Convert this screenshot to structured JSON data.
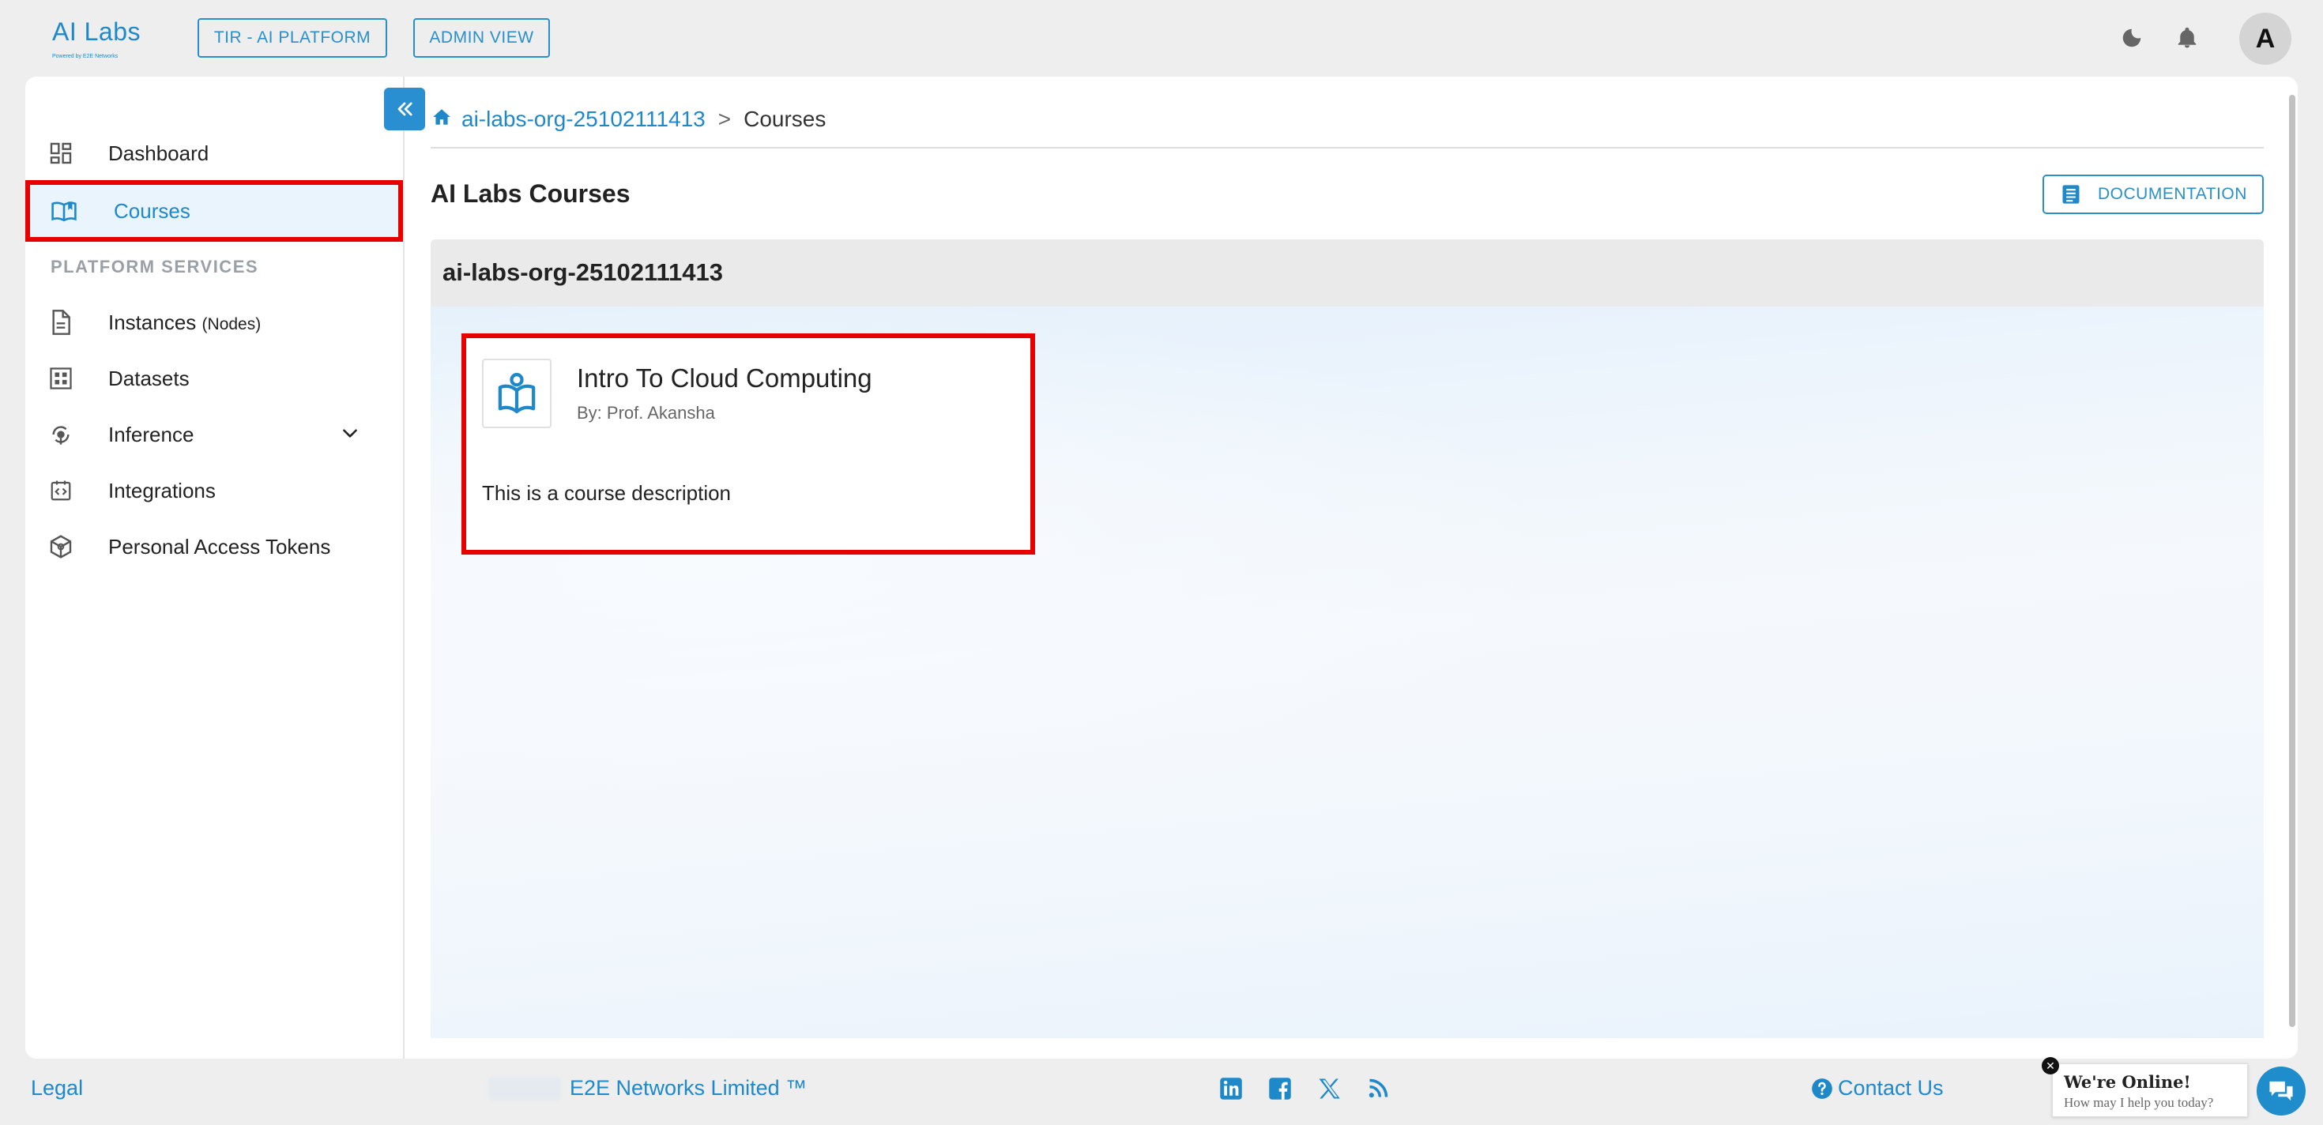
{
  "app": {
    "logo_text": "AI Labs",
    "logo_subtext": "Powered by E2E Networks",
    "brand_color": "#1e88c9",
    "highlight_color": "#e60000"
  },
  "topbar": {
    "buttons": [
      {
        "label": "TIR - AI PLATFORM"
      },
      {
        "label": "ADMIN VIEW"
      }
    ],
    "icons": [
      "moon-icon",
      "bell-icon"
    ],
    "avatar_letter": "A"
  },
  "sidebar": {
    "items": [
      {
        "label": "Dashboard",
        "icon": "dashboard-icon"
      },
      {
        "label": "Courses",
        "icon": "book-icon",
        "active": true
      }
    ],
    "section_title": "PLATFORM SERVICES",
    "services": [
      {
        "label": "Instances",
        "suffix": "(Nodes)",
        "icon": "document-icon"
      },
      {
        "label": "Datasets",
        "icon": "grid-icon"
      },
      {
        "label": "Inference",
        "icon": "inference-icon",
        "expandable": true
      },
      {
        "label": "Integrations",
        "icon": "integration-icon"
      },
      {
        "label": "Personal Access Tokens",
        "icon": "token-icon"
      }
    ]
  },
  "breadcrumb": {
    "org": "ai-labs-org-25102111413",
    "separator": ">",
    "current": "Courses"
  },
  "main": {
    "title": "AI Labs Courses",
    "doc_button": "DOCUMENTATION",
    "org_title": "ai-labs-org-25102111413",
    "courses": [
      {
        "title": "Intro To Cloud Computing",
        "author": "By: Prof. Akansha",
        "description": "This is a course description"
      }
    ]
  },
  "footer": {
    "legal": "Legal",
    "company": "E2E Networks Limited ™",
    "social_icons": [
      "linkedin-icon",
      "facebook-icon",
      "x-icon",
      "rss-icon"
    ],
    "contact": "Contact Us"
  },
  "chat": {
    "title": "We're Online!",
    "subtitle": "How may I help you today?"
  }
}
